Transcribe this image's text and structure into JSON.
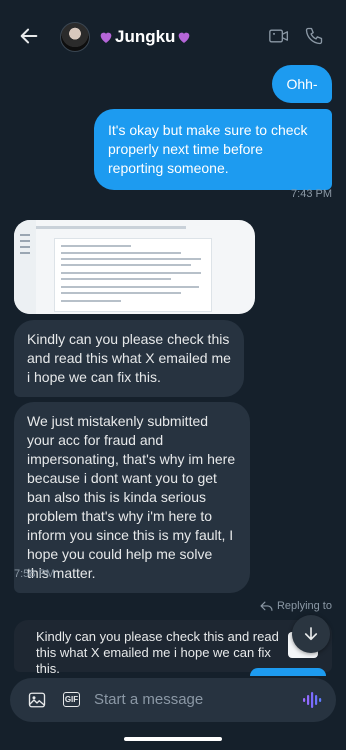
{
  "header": {
    "title": "Jungku"
  },
  "messages": {
    "m1": "Ohh-",
    "m2": "It's okay but make sure to check properly next time before reporting someone.",
    "t1": "7:43 PM",
    "m3": "Kindly can you please check this and read this what X emailed me i hope we can fix this.",
    "m4": "We just mistakenly submitted your acc for fraud and impersonating, that's why im here because i dont want you to get ban also this is kinda serious problem that's why i'm here to inform you since this is my fault, I hope you could help me solve this matter.",
    "t2": "7:58 PM"
  },
  "reply": {
    "label": "Replying to",
    "text": "Kindly can you please check this and read this what X emailed me i hope we can fix this."
  },
  "composer": {
    "placeholder": "Start a message",
    "gif_label": "GIF"
  },
  "colors": {
    "background": "#15202b",
    "accent": "#1d9bf0",
    "incoming": "#273340",
    "heart": "#b566d8"
  }
}
